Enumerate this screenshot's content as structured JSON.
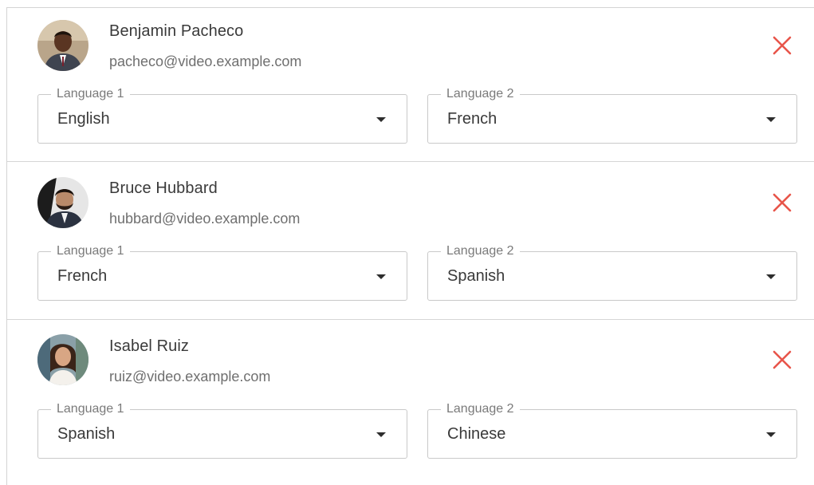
{
  "participants": [
    {
      "name": "Benjamin Pacheco",
      "email": "pacheco@video.example.com",
      "avatar_icon": "person-avatar",
      "language1": {
        "label": "Language 1",
        "value": "English"
      },
      "language2": {
        "label": "Language 2",
        "value": "French"
      }
    },
    {
      "name": "Bruce Hubbard",
      "email": "hubbard@video.example.com",
      "avatar_icon": "person-avatar",
      "language1": {
        "label": "Language 1",
        "value": "French"
      },
      "language2": {
        "label": "Language 2",
        "value": "Spanish"
      }
    },
    {
      "name": "Isabel Ruiz",
      "email": "ruiz@video.example.com",
      "avatar_icon": "person-avatar",
      "language1": {
        "label": "Language 1",
        "value": "Spanish"
      },
      "language2": {
        "label": "Language 2",
        "value": "Chinese"
      }
    }
  ],
  "colors": {
    "remove_icon": "#e8554a",
    "border": "#c9c9c9",
    "divider": "#d6d6d6"
  }
}
